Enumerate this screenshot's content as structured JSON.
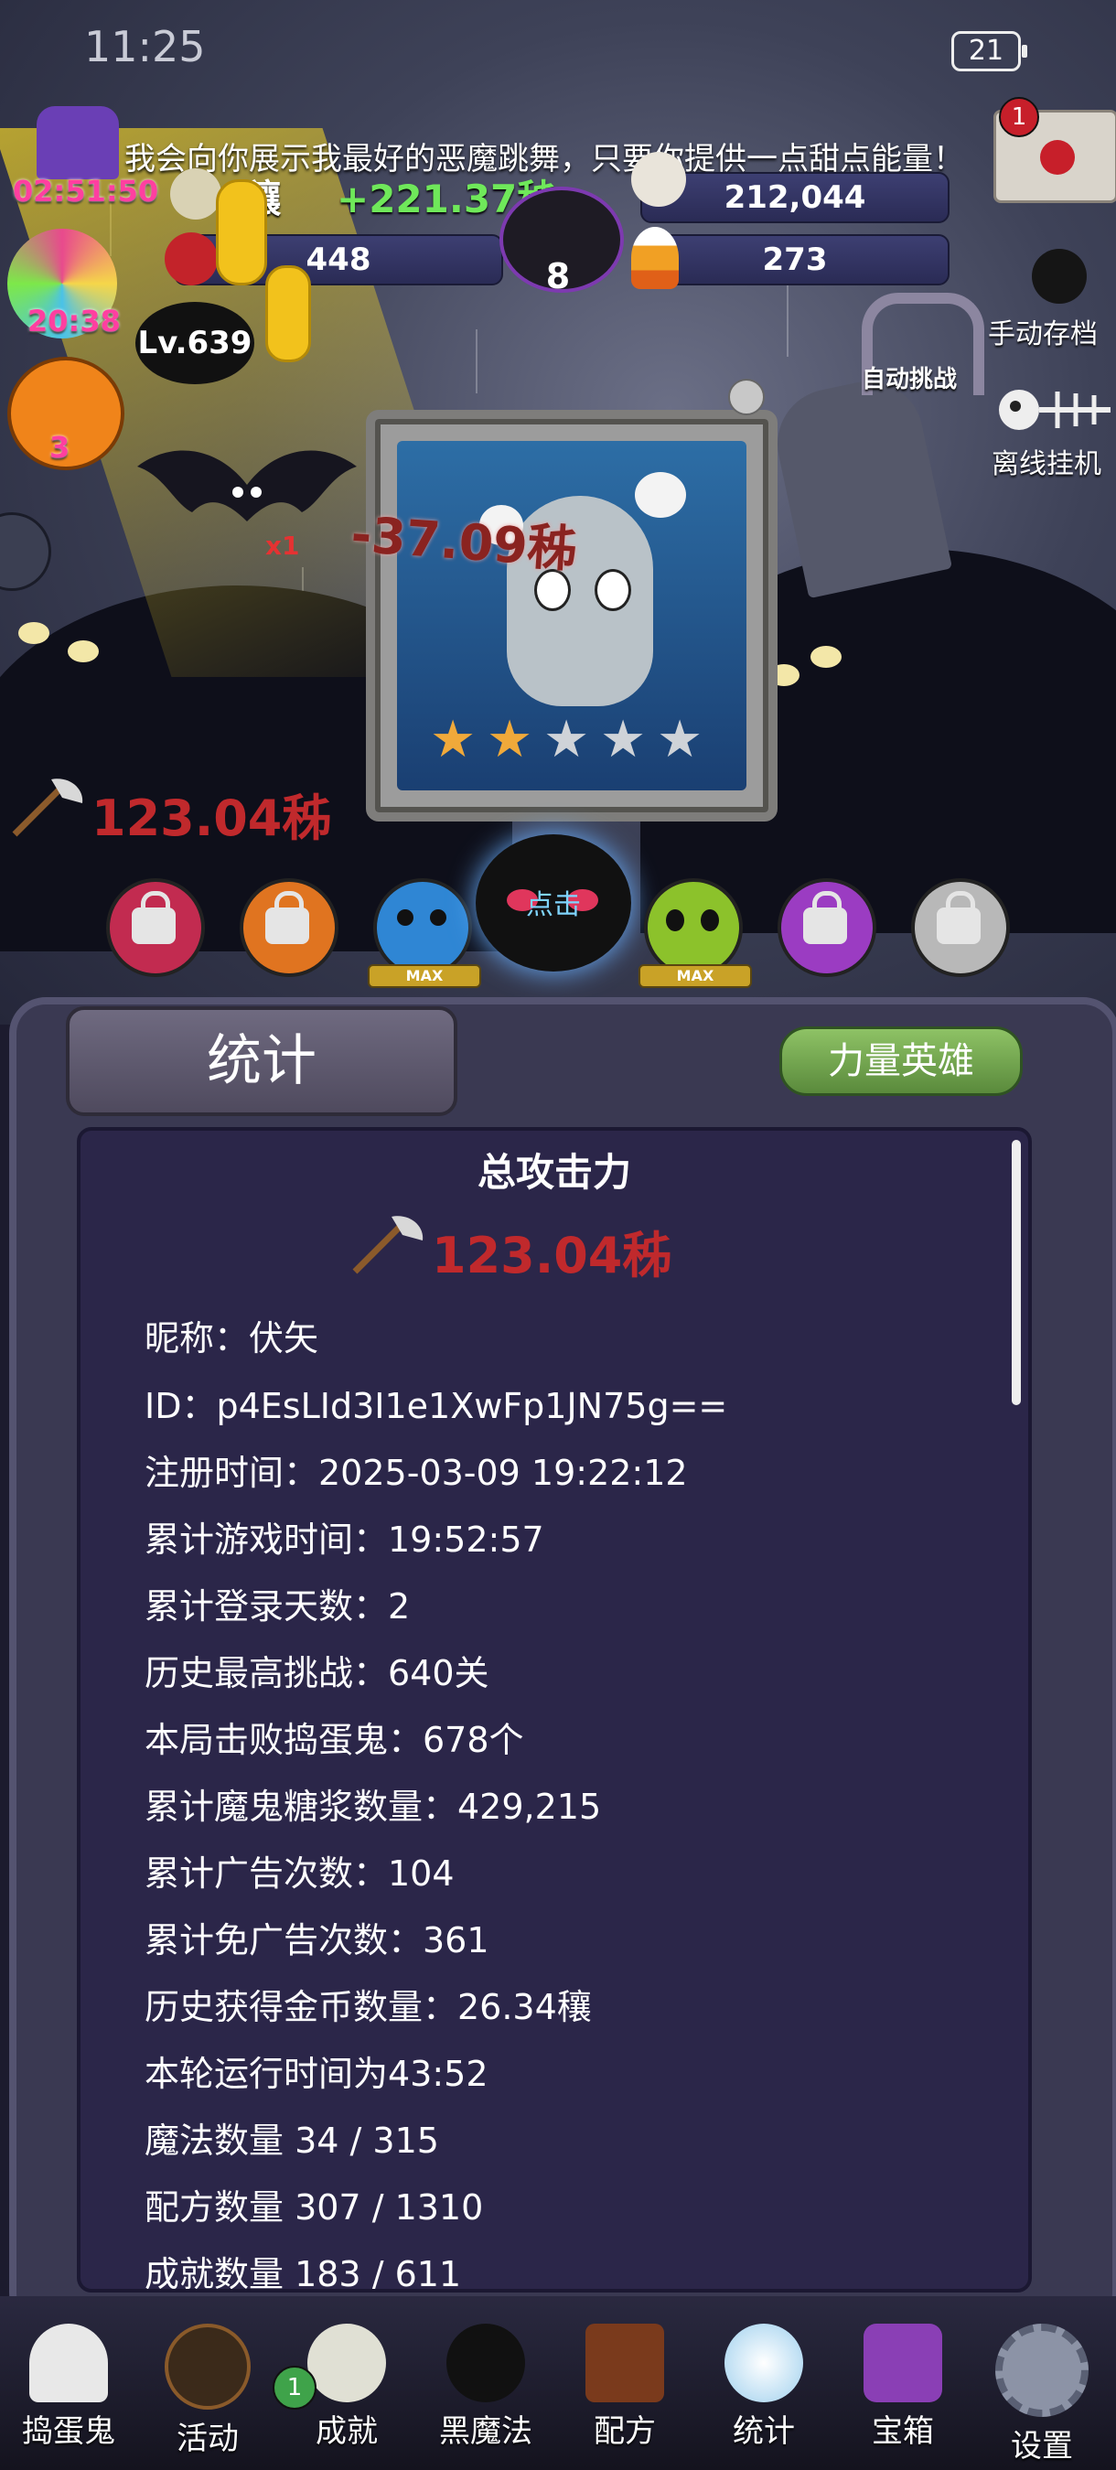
{
  "status_bar": {
    "time": "11:25",
    "battery": "21"
  },
  "notice": "我会向你展示我最好的恶魔跳舞，只要你提供一点甜点能量！",
  "resources": {
    "gold": "4穰",
    "gold_rate": "+221.37秭",
    "syrup": "212,044",
    "candy_apple": "448",
    "cauldron": "8",
    "candy_corn": "273"
  },
  "timers": {
    "witch_hat": "02:51:50",
    "lollipop": "20:38",
    "pumpkin": "3"
  },
  "level": "Lv.639",
  "side_buttons": {
    "auto": "自动挑战",
    "save": "手动存档",
    "offline": "离线挂机"
  },
  "mail_badge": "1",
  "boss": {
    "stars_filled": 2,
    "stars_total": 5
  },
  "bat_multiplier": "x1",
  "damage_float": "-37.09秭",
  "attack_power": "123.04秭",
  "click_label": "点击",
  "max_label": "MAX",
  "panel": {
    "tab": "统计",
    "hero_button": "力量英雄",
    "title": "总攻击力",
    "total_attack": "123.04秭",
    "stats": [
      "昵称：伏矢",
      "ID：p4EsLId3I1e1XwFp1JN75g==",
      "注册时间：2025-03-09 19:22:12",
      "累计游戏时间：19:52:57",
      "累计登录天数：2",
      "历史最高挑战：640关",
      "本局击败捣蛋鬼：678个",
      "累计魔鬼糖浆数量：429,215",
      "累计广告次数：104",
      "累计免广告次数：361",
      "历史获得金币数量：26.34穰",
      "本轮运行时间为43:52",
      "魔法数量 34 / 315",
      "配方数量 307 / 1310",
      "成就数量 183 / 611"
    ]
  },
  "nav": {
    "items": [
      "捣蛋鬼",
      "活动",
      "成就",
      "黑魔法",
      "配方",
      "统计",
      "宝箱",
      "设置"
    ],
    "badge": "1"
  },
  "colors": {
    "accent_red": "#c0292c",
    "gold_rate_green": "#6fe85a",
    "timer_pink": "#ff3fa0"
  }
}
